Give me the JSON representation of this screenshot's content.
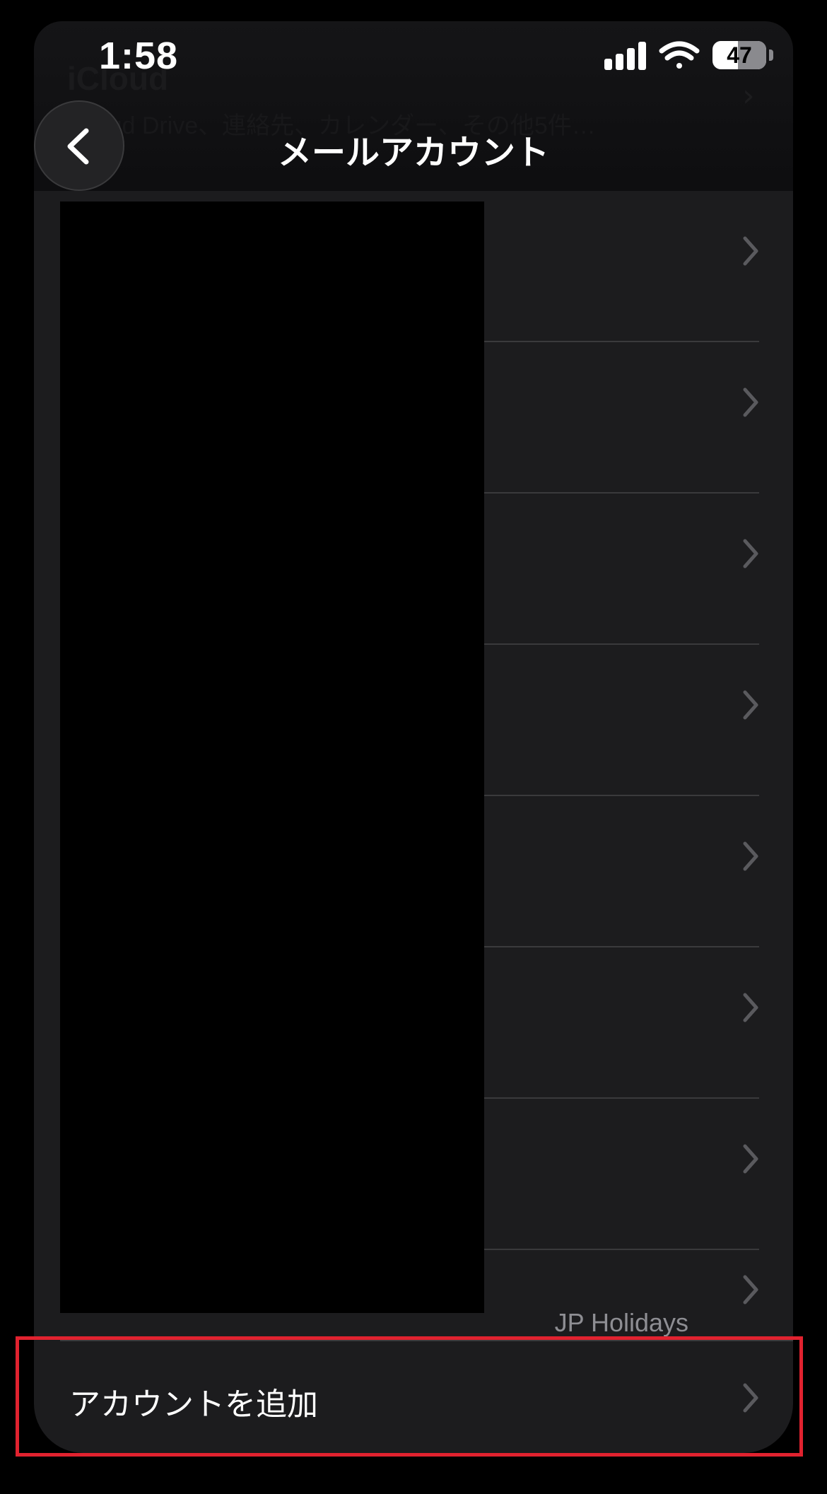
{
  "status_bar": {
    "time": "1:58",
    "battery": "47",
    "icons": [
      "cellular-signal-icon",
      "wifi-icon",
      "battery-icon"
    ]
  },
  "background": {
    "title": "iCloud",
    "subtitle": "iCloud Drive、連絡先、カレンダー、その他5件…"
  },
  "nav": {
    "back_icon": "chevron-left-icon",
    "title": "メールアカウント"
  },
  "accounts": {
    "rows": [
      {
        "detail": ""
      },
      {
        "detail": ""
      },
      {
        "detail": ""
      },
      {
        "detail": ""
      },
      {
        "detail": ""
      },
      {
        "detail": ""
      },
      {
        "detail": ""
      },
      {
        "detail": "JP Holidays"
      }
    ],
    "add_account_label": "アカウントを追加"
  },
  "colors": {
    "background": "#000000",
    "card": "#1c1c1e",
    "separator": "#3a3a3c",
    "secondary_text": "#8e8e93",
    "highlight": "#e1222f"
  }
}
